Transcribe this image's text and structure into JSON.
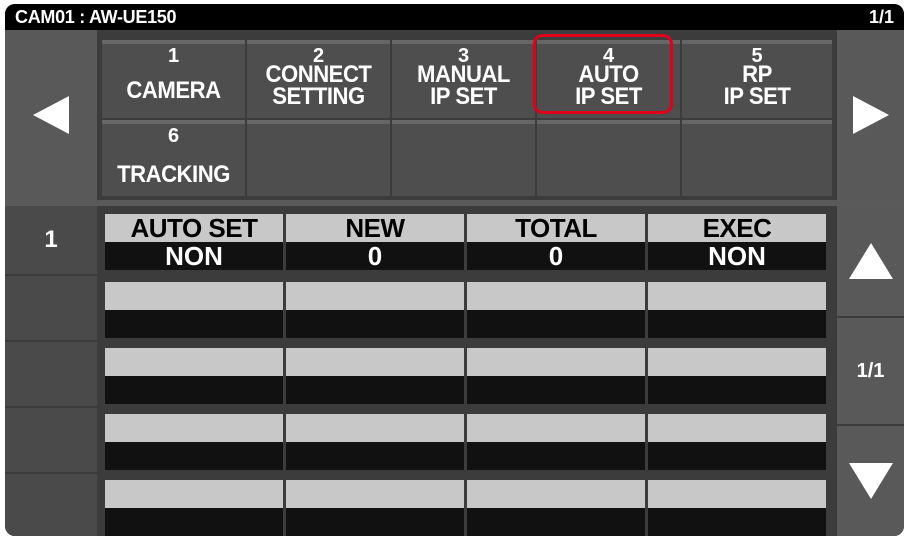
{
  "header": {
    "title": "CAM01 : AW-UE150",
    "page": "1/1"
  },
  "tabs": [
    {
      "num": "1",
      "line1": "",
      "line2": "CAMERA"
    },
    {
      "num": "2",
      "line1": "CONNECT",
      "line2": "SETTING"
    },
    {
      "num": "3",
      "line1": "MANUAL",
      "line2": "IP SET"
    },
    {
      "num": "4",
      "line1": "AUTO",
      "line2": "IP SET"
    },
    {
      "num": "5",
      "line1": "RP",
      "line2": "IP SET"
    },
    {
      "num": "6",
      "line1": "",
      "line2": "TRACKING"
    }
  ],
  "selected_tab": "4",
  "rows": [
    {
      "label": "1",
      "cells": [
        {
          "header": "AUTO SET",
          "value": "NON"
        },
        {
          "header": "NEW",
          "value": "0"
        },
        {
          "header": "TOTAL",
          "value": "0"
        },
        {
          "header": "EXEC",
          "value": "NON"
        }
      ]
    }
  ],
  "list_page": "1/1",
  "colors": {
    "selection_outline": "#e0001a",
    "header_cell": "#c8c8c8",
    "value_cell": "#111111"
  }
}
